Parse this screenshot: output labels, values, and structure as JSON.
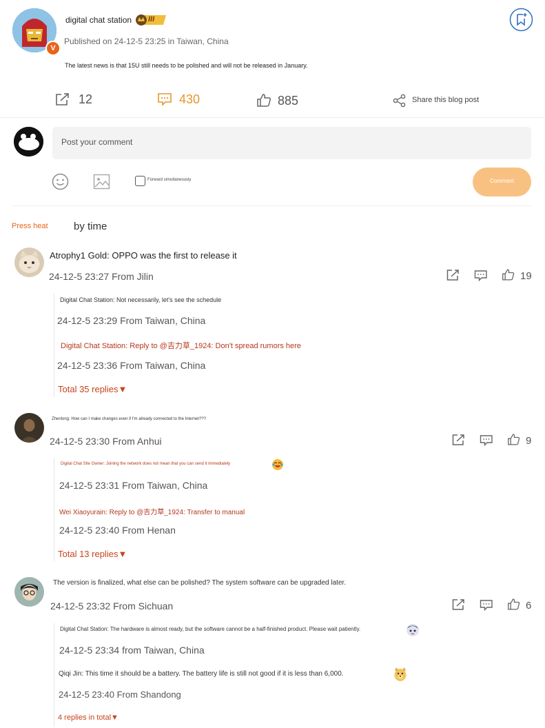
{
  "post": {
    "author": "digital chat station",
    "badge_level": "III",
    "verified_mark": "V",
    "published": "Published on 24-12-5 23:25 in Taiwan, China",
    "text": "The latest news is that 15U still needs to be polished and will not be released in January.",
    "stats": {
      "reposts": "12",
      "comments": "430",
      "likes": "885",
      "share_label": "Share this blog post"
    }
  },
  "composer": {
    "placeholder": "Post your comment",
    "forward_label": "Forward simultaneously",
    "submit_label": "Comment"
  },
  "sort": {
    "hot": "Press heat",
    "time": "by time"
  },
  "comments": [
    {
      "text": "Atrophy1 Gold: OPPO was the first to release it",
      "meta": "24-12-5 23:27 From Jilin",
      "likes": "19",
      "replies": [
        {
          "text": "Digital Chat Station: Not necessarily, let's see the schedule",
          "meta": "24-12-5 23:29 From Taiwan, China"
        },
        {
          "text": "Digital Chat Station: Reply to @吉力草_1924: Don't spread rumors here",
          "meta": "24-12-5 23:36 From Taiwan, China"
        }
      ],
      "total": "Total 35 replies▼"
    },
    {
      "text": "Zhenlong: How can I make changes even if I'm already connected to the Internet???",
      "meta": "24-12-5 23:30 From Anhui",
      "likes": "9",
      "replies": [
        {
          "text": "Digital Chat Site Owner: Joining the network does not mean that you can send it immediately",
          "meta": "24-12-5 23:31 From Taiwan, China"
        },
        {
          "text": "Wei Xiaoyurain: Reply to @吉力草_1924: Transfer to manual",
          "meta": "24-12-5 23:40 From Henan"
        }
      ],
      "total": "Total 13 replies▼"
    },
    {
      "text": "The version is finalized, what else can be polished? The system software can be upgraded later.",
      "meta": "24-12-5 23:32 From Sichuan",
      "likes": "6",
      "replies": [
        {
          "text": "Digital Chat Station: The hardware is almost ready, but the software cannot be a half-finished product. Please wait patiently.",
          "meta": "24-12-5 23:34 from Taiwan, China"
        },
        {
          "text": "Qiqi Jin: This time it should be a battery. The battery life is still not good if it is less than 6,000.",
          "meta": "24-12-5 23:40 From Shandong"
        }
      ],
      "total": "4 replies in total▼"
    }
  ],
  "colors": {
    "accent_orange": "#e8962a",
    "reply_red": "#c8431b",
    "comment_button": "#f8c182",
    "divider": "#eeeeee"
  }
}
